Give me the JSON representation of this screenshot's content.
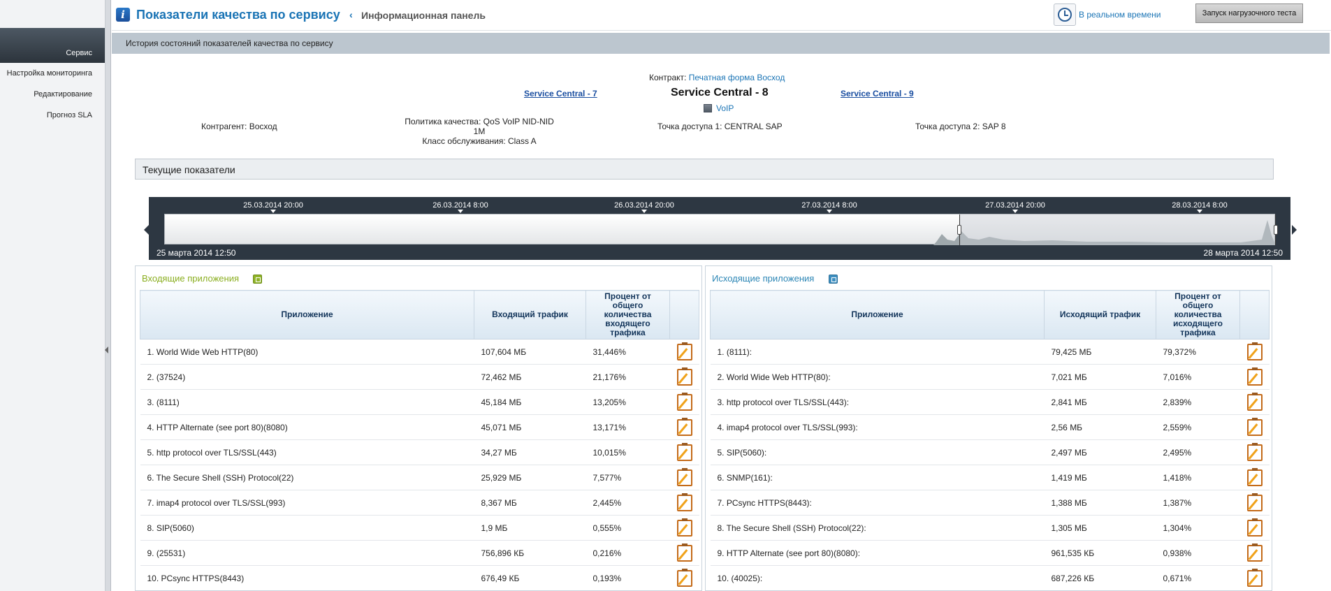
{
  "sidebar": {
    "items": [
      {
        "label": "Сервис",
        "active": true
      },
      {
        "label": "Настройка мониторинга",
        "active": false
      },
      {
        "label": "Редактирование",
        "active": false
      },
      {
        "label": "Прогноз SLA",
        "active": false
      }
    ]
  },
  "header": {
    "title": "Показатели качества по сервису",
    "back": "‹",
    "breadcrumb": "Информационная панель",
    "realtime_label": "В реальном времени",
    "load_test_label": "Запуск нагрузочного теста"
  },
  "history_bar": {
    "label": "История состояний показателей качества по сервису"
  },
  "info": {
    "contract_label": "Контракт:",
    "contract_value": "Печатная форма Восход",
    "prev_service": "Service Central - 7",
    "current_service": "Service Central - 8",
    "next_service": "Service Central - 9",
    "service_type": "VoIP",
    "counterparty": "Контрагент: Восход",
    "policy_line1": "Политика качества: QoS VoIP NID-NID 1M",
    "policy_line2": "Класс обслуживания: Class A",
    "access_point1": "Точка доступа 1: CENTRAL SAP",
    "access_point2": "Точка доступа 2: SAP 8"
  },
  "current_section": {
    "label": "Текущие показатели"
  },
  "timeline": {
    "ticks": [
      "25.03.2014 20:00",
      "26.03.2014 8:00",
      "26.03.2014 20:00",
      "27.03.2014 8:00",
      "27.03.2014 20:00",
      "28.03.2014 8:00"
    ],
    "range_start": "25 марта 2014 12:50",
    "range_end": "28 марта 2014 12:50",
    "selection_fraction": [
      0.715,
      1.0
    ]
  },
  "inbound": {
    "title": "Входящие приложения",
    "headers": [
      "Приложение",
      "Входящий трафик",
      "Процент от общего количества входящего трафика",
      ""
    ],
    "rows": [
      [
        "1. World Wide Web HTTP(80)",
        "107,604 МБ",
        "31,446%"
      ],
      [
        "2. (37524)",
        "72,462 МБ",
        "21,176%"
      ],
      [
        "3. (8111)",
        "45,184 МБ",
        "13,205%"
      ],
      [
        "4. HTTP Alternate (see port 80)(8080)",
        "45,071 МБ",
        "13,171%"
      ],
      [
        "5. http protocol over TLS/SSL(443)",
        "34,27 МБ",
        "10,015%"
      ],
      [
        "6. The Secure Shell (SSH) Protocol(22)",
        "25,929 МБ",
        "7,577%"
      ],
      [
        "7. imap4 protocol over TLS/SSL(993)",
        "8,367 МБ",
        "2,445%"
      ],
      [
        "8. SIP(5060)",
        "1,9 МБ",
        "0,555%"
      ],
      [
        "9. (25531)",
        "756,896 КБ",
        "0,216%"
      ],
      [
        "10. PCsync HTTPS(8443)",
        "676,49 КБ",
        "0,193%"
      ]
    ]
  },
  "outbound": {
    "title": "Исходящие приложения",
    "headers": [
      "Приложение",
      "Исходящий трафик",
      "Процент от общего количества исходящего трафика",
      ""
    ],
    "rows": [
      [
        "1. (8111):",
        "79,425 МБ",
        "79,372%"
      ],
      [
        "2. World Wide Web HTTP(80):",
        "7,021 МБ",
        "7,016%"
      ],
      [
        "3. http protocol over TLS/SSL(443):",
        "2,841 МБ",
        "2,839%"
      ],
      [
        "4. imap4 protocol over TLS/SSL(993):",
        "2,56 МБ",
        "2,559%"
      ],
      [
        "5. SIP(5060):",
        "2,497 МБ",
        "2,495%"
      ],
      [
        "6. SNMP(161):",
        "1,419 МБ",
        "1,418%"
      ],
      [
        "7. PCsync HTTPS(8443):",
        "1,388 МБ",
        "1,387%"
      ],
      [
        "8. The Secure Shell (SSH) Protocol(22):",
        "1,305 МБ",
        "1,304%"
      ],
      [
        "9. HTTP Alternate (see port 80)(8080):",
        "961,535 КБ",
        "0,938%"
      ],
      [
        "10. (40025):",
        "687,226 КБ",
        "0,671%"
      ]
    ]
  },
  "icons": {
    "info": "info-icon",
    "clock": "clock-icon",
    "export_in": "export-icon",
    "export_out": "export-icon",
    "row_action": "edit-clipboard-icon"
  },
  "colors": {
    "accent": "#1a74b5",
    "inbound_title": "#8aae1f",
    "outbound_title": "#2c86b5",
    "timeline_bg": "#2d3742"
  }
}
